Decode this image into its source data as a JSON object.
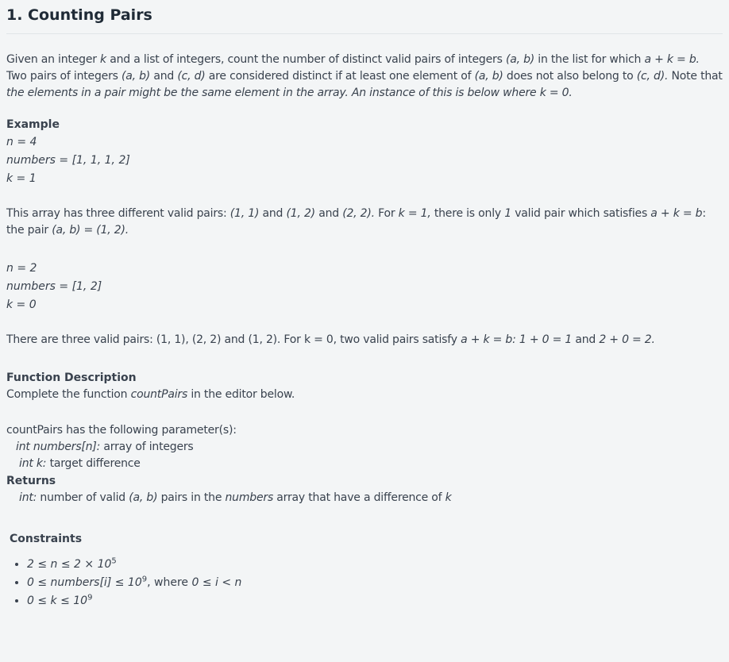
{
  "title": "1. Counting Pairs",
  "intro": [
    {
      "t": "Given an integer "
    },
    {
      "t": "k",
      "i": 1
    },
    {
      "t": " and a list of integers, count the number of distinct valid pairs of integers "
    },
    {
      "t": "(a, b)",
      "i": 1
    },
    {
      "t": " in the list for which "
    },
    {
      "t": "a + k = b.",
      "i": 1
    },
    {
      "t": " Two pairs of integers "
    },
    {
      "t": "(a, b)",
      "i": 1
    },
    {
      "t": " and "
    },
    {
      "t": "(c, d)",
      "i": 1
    },
    {
      "t": " are considered distinct if at least one element of "
    },
    {
      "t": "(a, b)",
      "i": 1
    },
    {
      "t": " does not also belong to "
    },
    {
      "t": "(c, d).",
      "i": 1
    },
    {
      "t": " Note that "
    },
    {
      "t": "the elements in a pair might be the same element in the array. An instance of this is below where k = 0.",
      "i": 1
    }
  ],
  "example_heading": "Example",
  "example1": [
    "n = 4",
    "numbers = [1, 1, 1, 2]",
    "k = 1"
  ],
  "explain1": [
    {
      "t": "This array has three different valid pairs: "
    },
    {
      "t": "(1, 1)",
      "i": 1
    },
    {
      "t": " and "
    },
    {
      "t": "(1, 2)",
      "i": 1
    },
    {
      "t": " and "
    },
    {
      "t": "(2, 2).",
      "i": 1
    },
    {
      "t": " For "
    },
    {
      "t": "k = 1,",
      "i": 1
    },
    {
      "t": " there is only "
    },
    {
      "t": "1",
      "i": 1
    },
    {
      "t": " valid pair which satisfies "
    },
    {
      "t": "a + k = b",
      "i": 1
    },
    {
      "t": ": the pair "
    },
    {
      "t": "(a, b) = (1, 2).",
      "i": 1
    }
  ],
  "example2": [
    "n = 2",
    "numbers = [1, 2]",
    "k = 0"
  ],
  "explain2": [
    {
      "t": "There are three valid pairs: (1, 1), (2, 2) and (1, 2). For k = 0, two valid pairs satisfy "
    },
    {
      "t": "a + k = b: 1 + 0 = 1",
      "i": 1
    },
    {
      "t": " and "
    },
    {
      "t": "2 + 0 = 2.",
      "i": 1
    }
  ],
  "function_heading": "Function Description",
  "function_text": [
    {
      "t": "Complete the function "
    },
    {
      "t": "countPairs",
      "i": 1
    },
    {
      "t": " in the editor below."
    }
  ],
  "params_intro": "countPairs has the following parameter(s):",
  "params": [
    [
      {
        "t": "int numbers[n]:",
        "i": 1
      },
      {
        "t": "  array of integers"
      }
    ],
    [
      {
        "t": "int k:",
        "i": 1
      },
      {
        "t": " target difference"
      }
    ]
  ],
  "returns_heading": "Returns",
  "returns": [
    {
      "t": "int:",
      "i": 1
    },
    {
      "t": " number of valid "
    },
    {
      "t": "(a, b)",
      "i": 1
    },
    {
      "t": " pairs in the "
    },
    {
      "t": "numbers",
      "i": 1
    },
    {
      "t": " array that have a difference of "
    },
    {
      "t": "k",
      "i": 1
    }
  ],
  "constraints_heading": "Constraints",
  "constraints": [
    [
      {
        "t": "2 ≤ n ≤ 2 × 10",
        "i": 1
      },
      {
        "t": "5",
        "i": 1,
        "sup": 1
      }
    ],
    [
      {
        "t": "0 ≤ numbers[i] ≤ 10",
        "i": 1
      },
      {
        "t": "9",
        "i": 1,
        "sup": 1
      },
      {
        "t": ", where "
      },
      {
        "t": "0 ≤ i < n",
        "i": 1
      }
    ],
    [
      {
        "t": "0 ≤ k ≤ 10",
        "i": 1
      },
      {
        "t": "9",
        "i": 1,
        "sup": 1
      }
    ]
  ]
}
